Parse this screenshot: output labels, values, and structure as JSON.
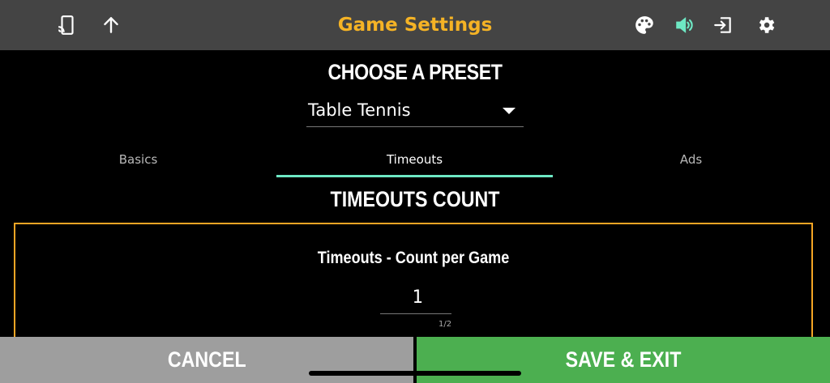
{
  "header": {
    "title": "Game Settings",
    "icons": [
      "cast-icon",
      "upload-icon",
      "palette-icon",
      "volume-icon",
      "exit-icon",
      "settings-icon"
    ],
    "title_color": "#f5b325",
    "volume_icon_color": "#6ee8c4"
  },
  "preset": {
    "heading": "CHOOSE A PRESET",
    "selected": "Table Tennis"
  },
  "tabs": [
    {
      "label": "Basics",
      "active": false
    },
    {
      "label": "Timeouts",
      "active": true
    },
    {
      "label": "Ads",
      "active": false
    }
  ],
  "section": {
    "heading": "TIMEOUTS COUNT",
    "field_label": "Timeouts - Count per Game",
    "field_value": "1",
    "field_counter": "1/2",
    "border_color": "#f5a524"
  },
  "footer": {
    "cancel_label": "CANCEL",
    "save_label": "SAVE & EXIT",
    "cancel_color": "#9e9e9e",
    "save_color": "#4caf50"
  }
}
